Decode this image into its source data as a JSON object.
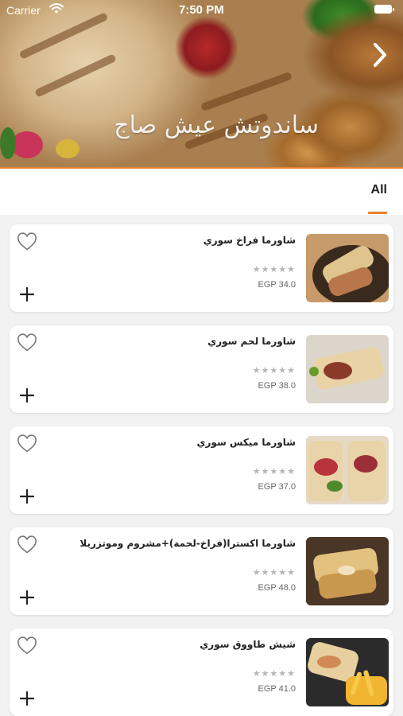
{
  "status_bar": {
    "carrier": "Carrier",
    "time": "7:50 PM"
  },
  "header": {
    "title": "ساندوتش عيش صاج",
    "next_icon": "chevron-right-icon"
  },
  "tabs": [
    {
      "label": "All",
      "selected": true
    }
  ],
  "colors": {
    "accent": "#e8822a",
    "star": "#b5b5b5",
    "background": "#f2f2f2"
  },
  "products": [
    {
      "name": "شاورما فراخ سوري",
      "rating": "★★★★★",
      "price": "EGP 34.0"
    },
    {
      "name": "شاورما لحم سوري",
      "rating": "★★★★★",
      "price": "EGP 38.0"
    },
    {
      "name": "شاورما ميكس سوري",
      "rating": "★★★★★",
      "price": "EGP 37.0"
    },
    {
      "name": "شاورما اكسترا(فراخ-لحمة)+مشروم وموتزريلا",
      "rating": "★★★★★",
      "price": "EGP 48.0"
    },
    {
      "name": "شيش طاووق سوري",
      "rating": "★★★★★",
      "price": "EGP 41.0"
    }
  ]
}
